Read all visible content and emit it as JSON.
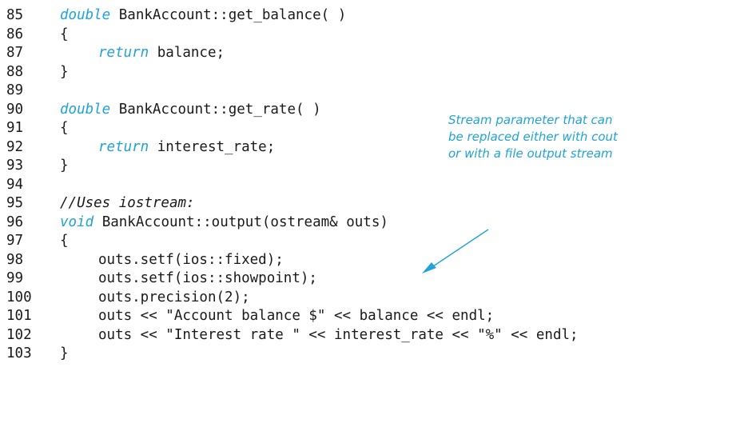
{
  "code_lines": [
    {
      "num": "85",
      "indent": 1,
      "tokens": [
        {
          "t": "double",
          "kw": true
        },
        {
          "t": " BankAccount::get_balance( )"
        }
      ]
    },
    {
      "num": "86",
      "indent": 1,
      "tokens": [
        {
          "t": "{"
        }
      ]
    },
    {
      "num": "87",
      "indent": 2,
      "tokens": [
        {
          "t": "return",
          "kw": true
        },
        {
          "t": " balance;"
        }
      ]
    },
    {
      "num": "88",
      "indent": 1,
      "tokens": [
        {
          "t": "}"
        }
      ]
    },
    {
      "num": "89",
      "indent": 1,
      "tokens": []
    },
    {
      "num": "90",
      "indent": 1,
      "tokens": [
        {
          "t": "double",
          "kw": true
        },
        {
          "t": " BankAccount::get_rate( )"
        }
      ]
    },
    {
      "num": "91",
      "indent": 1,
      "tokens": [
        {
          "t": "{"
        }
      ]
    },
    {
      "num": "92",
      "indent": 2,
      "tokens": [
        {
          "t": "return",
          "kw": true
        },
        {
          "t": " interest_rate;"
        }
      ]
    },
    {
      "num": "93",
      "indent": 1,
      "tokens": [
        {
          "t": "}"
        }
      ]
    },
    {
      "num": "94",
      "indent": 1,
      "tokens": []
    },
    {
      "num": "95",
      "indent": 1,
      "tokens": [
        {
          "t": "//Uses iostream:",
          "cm": true
        }
      ]
    },
    {
      "num": "96",
      "indent": 1,
      "tokens": [
        {
          "t": "void",
          "kw": true
        },
        {
          "t": " BankAccount::output(ostream& outs)"
        }
      ]
    },
    {
      "num": "97",
      "indent": 1,
      "tokens": [
        {
          "t": "{"
        }
      ]
    },
    {
      "num": "98",
      "indent": 2,
      "tokens": [
        {
          "t": "outs.setf(ios::fixed);"
        }
      ]
    },
    {
      "num": "99",
      "indent": 2,
      "tokens": [
        {
          "t": "outs.setf(ios::showpoint);"
        }
      ]
    },
    {
      "num": "100",
      "indent": 2,
      "tokens": [
        {
          "t": "outs.precision(2);"
        }
      ]
    },
    {
      "num": "101",
      "indent": 2,
      "tokens": [
        {
          "t": "outs << \"Account balance $\" << balance << endl;"
        }
      ]
    },
    {
      "num": "102",
      "indent": 2,
      "tokens": [
        {
          "t": "outs << \"Interest rate \" << interest_rate << \"%\" << endl;"
        }
      ]
    },
    {
      "num": "103",
      "indent": 1,
      "tokens": [
        {
          "t": "}"
        }
      ]
    }
  ],
  "annotation": {
    "lines": [
      "Stream parameter that can",
      "be replaced either with cout",
      "or with a file output stream"
    ]
  },
  "colors": {
    "keyword": "#1fa3d8",
    "annotation": "#1fa3d8",
    "text": "#1a1a1a"
  }
}
